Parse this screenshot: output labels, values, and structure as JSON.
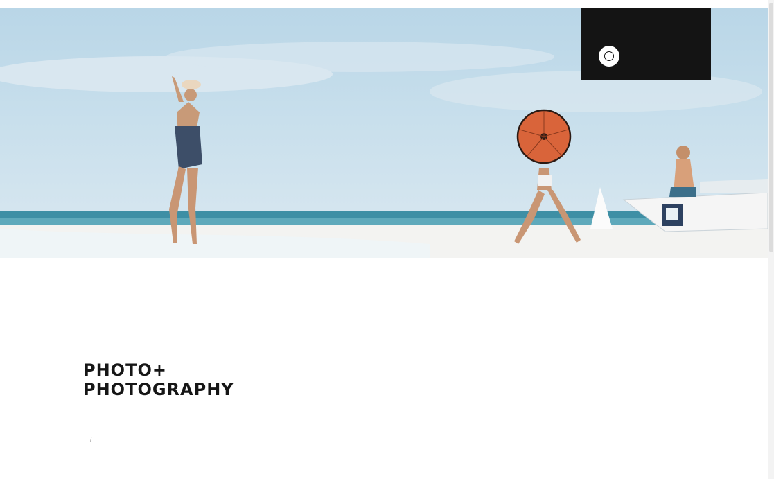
{
  "hero": {
    "image_name": "beach-scene",
    "colors": {
      "sky": "#bcd8e8",
      "sea": "#3e8fa5",
      "sand": "#f3f3f1",
      "umbrella": "#d9643a"
    }
  },
  "promo": {
    "title": "",
    "subtitle": "",
    "button_icon": "circle-arrow-icon"
  },
  "brand": {
    "line1": "PHOTO+",
    "line2": "PHOTOGRAPHY"
  },
  "contact": {
    "phone": "",
    "email": "",
    "separator": "/"
  },
  "about": {
    "heading": "",
    "text": ""
  },
  "social": {
    "items": [
      "",
      "",
      ""
    ]
  },
  "side": {
    "label": "",
    "value": "",
    "bottom": ""
  }
}
